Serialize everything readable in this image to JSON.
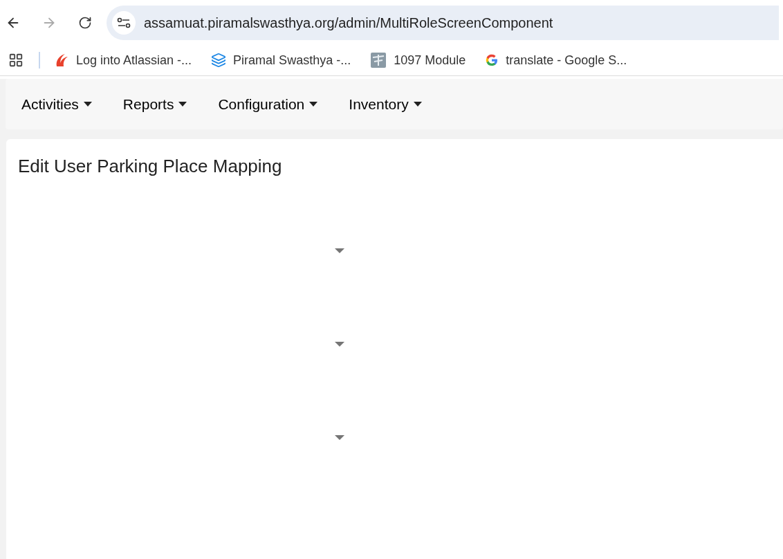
{
  "browser": {
    "url": "assamuat.piramalswasthya.org/admin/MultiRoleScreenComponent",
    "forward_disabled": true,
    "bookmarks": [
      {
        "kind": "atlassian",
        "label": "Log into Atlassian -..."
      },
      {
        "kind": "layers",
        "label": "Piramal Swasthya -..."
      },
      {
        "kind": "module",
        "label": "1097 Module"
      },
      {
        "kind": "google",
        "label": "translate - Google S..."
      }
    ]
  },
  "nav": [
    {
      "label": "Activities"
    },
    {
      "label": "Reports"
    },
    {
      "label": "Configuration"
    },
    {
      "label": "Inventory"
    }
  ],
  "page": {
    "title": "Edit User Parking Place Mapping",
    "dropdowns": [
      {
        "expanded": false
      },
      {
        "expanded": false
      },
      {
        "expanded": false
      }
    ]
  }
}
